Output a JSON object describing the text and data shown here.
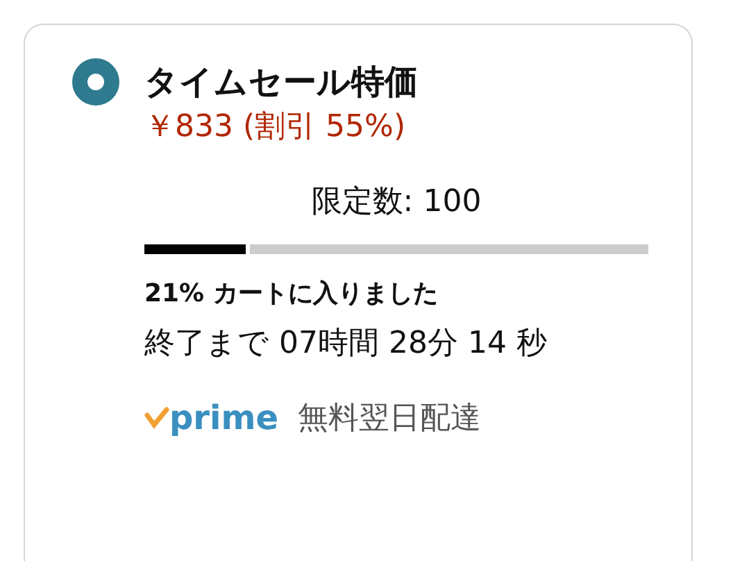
{
  "deal": {
    "selected": true,
    "title": "タイムセール特価",
    "price": "￥833 (割引 55%)",
    "limit": "限定数: 100",
    "claimed": {
      "level": 0.2
    },
    "claimed_text": "21% カートに入りました",
    "countdown": "終了まで 07時間 28分 14 秒",
    "prime_logo": "prime",
    "delivery": "無料翌日配達"
  }
}
